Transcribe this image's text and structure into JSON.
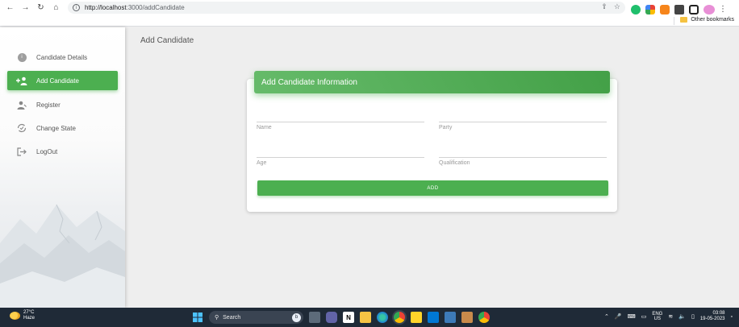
{
  "browser": {
    "back_icon": "←",
    "forward_icon": "→",
    "reload_icon": "↻",
    "home_icon": "⌂",
    "url_host": "http://localhost",
    "url_path": ":3000/addCandidate",
    "share_icon": "⇪",
    "star_icon": "☆",
    "other_bookmarks": "Other bookmarks",
    "menu_icon": "⋮"
  },
  "sidebar": {
    "items": [
      {
        "label": "Candidate Details",
        "icon": "ⓘ"
      },
      {
        "label": "Add Candidate",
        "icon": "➕"
      },
      {
        "label": "Register",
        "icon": "👤"
      },
      {
        "label": "Change State",
        "icon": "⟳"
      },
      {
        "label": "LogOut",
        "icon": "⇥"
      }
    ]
  },
  "page": {
    "title": "Add Candidate"
  },
  "form": {
    "header": "Add Candidate Information",
    "name_label": "Name",
    "party_label": "Party",
    "age_label": "Age",
    "qualification_label": "Qualification",
    "add_button": "ADD"
  },
  "taskbar": {
    "temp": "27°C",
    "weather": "Haze",
    "search": "Search",
    "lang_top": "ENG",
    "lang_bottom": "US",
    "time": "03:08",
    "date": "19-05-2023"
  },
  "colors": {
    "accent": "#4caf50",
    "taskbar": "#1f2a37"
  }
}
